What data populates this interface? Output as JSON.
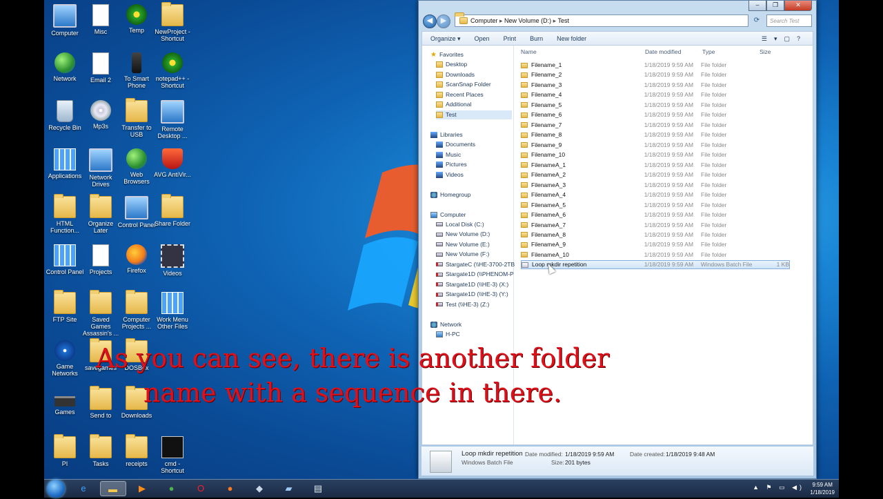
{
  "desktop": {
    "icons": [
      {
        "label": "Computer",
        "type": "monitor"
      },
      {
        "label": "Misc",
        "type": "docicon"
      },
      {
        "label": "Temp",
        "type": "green"
      },
      {
        "label": "NewProject - Shortcut",
        "type": "folder"
      },
      {
        "label": "Network",
        "type": "globe"
      },
      {
        "label": "Email 2",
        "type": "docicon"
      },
      {
        "label": "To Smart Phone",
        "type": "phone"
      },
      {
        "label": "notepad++ - Shortcut",
        "type": "green"
      },
      {
        "label": "Recycle Bin",
        "type": "bin"
      },
      {
        "label": "Mp3s",
        "type": "cd"
      },
      {
        "label": "Transfer to USB",
        "type": "folder"
      },
      {
        "label": "Remote Desktop ...",
        "type": "monitor"
      },
      {
        "label": "Applications",
        "type": "grid4"
      },
      {
        "label": "Network Drives",
        "type": "monitor"
      },
      {
        "label": "Web Browsers",
        "type": "globe"
      },
      {
        "label": "AVG AntiVir...",
        "type": "redshield"
      },
      {
        "label": "HTML Function...",
        "type": "folder"
      },
      {
        "label": "Organize Later",
        "type": "folder"
      },
      {
        "label": "Control Panel",
        "type": "monitor"
      },
      {
        "label": "Share Folder",
        "type": "folder"
      },
      {
        "label": "Control Panel",
        "type": "grid4"
      },
      {
        "label": "Projects",
        "type": "docicon"
      },
      {
        "label": "Firefox",
        "type": "firefox"
      },
      {
        "label": "Videos",
        "type": "film"
      },
      {
        "label": "FTP Site",
        "type": "folder"
      },
      {
        "label": "Saved Games Assassin's ...",
        "type": "folder"
      },
      {
        "label": "Computer Projects ...",
        "type": "folder"
      },
      {
        "label": "Work Menu Other Files",
        "type": "grid4"
      },
      {
        "label": "Game Networks",
        "type": "speaker"
      },
      {
        "label": "savegames",
        "type": "folder"
      },
      {
        "label": "DOSBox",
        "type": "folder"
      },
      {
        "label": "",
        "type": "none"
      },
      {
        "label": "Games",
        "type": "chip"
      },
      {
        "label": "Send to",
        "type": "folder"
      },
      {
        "label": "Downloads",
        "type": "folder"
      },
      {
        "label": "",
        "type": "none"
      },
      {
        "label": "PI",
        "type": "folder"
      },
      {
        "label": "Tasks",
        "type": "folder"
      },
      {
        "label": "receipts",
        "type": "folder"
      },
      {
        "label": "cmd - Shortcut",
        "type": "cmd"
      }
    ]
  },
  "explorer": {
    "address_parts": [
      "Computer",
      "New Volume (D:)",
      "Test"
    ],
    "search_placeholder": "Search Test",
    "toolbar": {
      "organize": "Organize ▾",
      "open": "Open",
      "print": "Print",
      "burn": "Burn",
      "new_folder": "New folder"
    },
    "nav": [
      {
        "label": "Favorites",
        "icon": "star",
        "indent": 0
      },
      {
        "label": "Desktop",
        "icon": "fold",
        "indent": 1
      },
      {
        "label": "Downloads",
        "icon": "fold",
        "indent": 1
      },
      {
        "label": "ScanSnap Folder",
        "icon": "fold",
        "indent": 1
      },
      {
        "label": "Recent Places",
        "icon": "fold",
        "indent": 1
      },
      {
        "label": "Additional",
        "icon": "fold",
        "indent": 1
      },
      {
        "label": "Test",
        "icon": "fold",
        "indent": 1,
        "selected": true
      },
      {
        "label": "",
        "icon": "none",
        "indent": 0
      },
      {
        "label": "Libraries",
        "icon": "lib",
        "indent": 0
      },
      {
        "label": "Documents",
        "icon": "lib",
        "indent": 1
      },
      {
        "label": "Music",
        "icon": "lib",
        "indent": 1
      },
      {
        "label": "Pictures",
        "icon": "lib",
        "indent": 1
      },
      {
        "label": "Videos",
        "icon": "lib",
        "indent": 1
      },
      {
        "label": "",
        "icon": "none",
        "indent": 0
      },
      {
        "label": "Homegroup",
        "icon": "net",
        "indent": 0
      },
      {
        "label": "",
        "icon": "none",
        "indent": 0
      },
      {
        "label": "Computer",
        "icon": "comp",
        "indent": 0
      },
      {
        "label": "Local Disk (C:)",
        "icon": "drive",
        "indent": 1
      },
      {
        "label": "New Volume (D:)",
        "icon": "drive",
        "indent": 1
      },
      {
        "label": "New Volume (E:)",
        "icon": "drive",
        "indent": 1
      },
      {
        "label": "New Volume (F:)",
        "icon": "drive",
        "indent": 1
      },
      {
        "label": "StargateC (\\\\HE-3700-2TB",
        "icon": "netdrive",
        "indent": 1
      },
      {
        "label": "Stargate1D (\\\\PHENOM-P",
        "icon": "netdrive",
        "indent": 1
      },
      {
        "label": "Stargate1D (\\\\HE-3) (X:)",
        "icon": "netdrive",
        "indent": 1
      },
      {
        "label": "Stargate1D (\\\\HE-3) (Y:)",
        "icon": "netdrive",
        "indent": 1
      },
      {
        "label": "Test (\\\\HE-3) (Z:)",
        "icon": "netdrive",
        "indent": 1
      },
      {
        "label": "",
        "icon": "none",
        "indent": 0
      },
      {
        "label": "Network",
        "icon": "net",
        "indent": 0
      },
      {
        "label": "H-PC",
        "icon": "comp",
        "indent": 1
      }
    ],
    "columns": {
      "name": "Name",
      "date": "Date modified",
      "type": "Type",
      "size": "Size"
    },
    "files": [
      {
        "name": "Filename_1",
        "date": "1/18/2019 9:59 AM",
        "type": "File folder",
        "size": ""
      },
      {
        "name": "Filename_2",
        "date": "1/18/2019 9:59 AM",
        "type": "File folder",
        "size": ""
      },
      {
        "name": "Filename_3",
        "date": "1/18/2019 9:59 AM",
        "type": "File folder",
        "size": ""
      },
      {
        "name": "Filename_4",
        "date": "1/18/2019 9:59 AM",
        "type": "File folder",
        "size": ""
      },
      {
        "name": "Filename_5",
        "date": "1/18/2019 9:59 AM",
        "type": "File folder",
        "size": ""
      },
      {
        "name": "Filename_6",
        "date": "1/18/2019 9:59 AM",
        "type": "File folder",
        "size": ""
      },
      {
        "name": "Filename_7",
        "date": "1/18/2019 9:59 AM",
        "type": "File folder",
        "size": ""
      },
      {
        "name": "Filename_8",
        "date": "1/18/2019 9:59 AM",
        "type": "File folder",
        "size": ""
      },
      {
        "name": "Filename_9",
        "date": "1/18/2019 9:59 AM",
        "type": "File folder",
        "size": ""
      },
      {
        "name": "Filename_10",
        "date": "1/18/2019 9:59 AM",
        "type": "File folder",
        "size": ""
      },
      {
        "name": "FilenameA_1",
        "date": "1/18/2019 9:59 AM",
        "type": "File folder",
        "size": ""
      },
      {
        "name": "FilenameA_2",
        "date": "1/18/2019 9:59 AM",
        "type": "File folder",
        "size": ""
      },
      {
        "name": "FilenameA_3",
        "date": "1/18/2019 9:59 AM",
        "type": "File folder",
        "size": ""
      },
      {
        "name": "FilenameA_4",
        "date": "1/18/2019 9:59 AM",
        "type": "File folder",
        "size": ""
      },
      {
        "name": "FilenameA_5",
        "date": "1/18/2019 9:59 AM",
        "type": "File folder",
        "size": ""
      },
      {
        "name": "FilenameA_6",
        "date": "1/18/2019 9:59 AM",
        "type": "File folder",
        "size": ""
      },
      {
        "name": "FilenameA_7",
        "date": "1/18/2019 9:59 AM",
        "type": "File folder",
        "size": ""
      },
      {
        "name": "FilenameA_8",
        "date": "1/18/2019 9:59 AM",
        "type": "File folder",
        "size": ""
      },
      {
        "name": "FilenameA_9",
        "date": "1/18/2019 9:59 AM",
        "type": "File folder",
        "size": ""
      },
      {
        "name": "FilenameA_10",
        "date": "1/18/2019 9:59 AM",
        "type": "File folder",
        "size": ""
      },
      {
        "name": "Loop mkdir repetition",
        "date": "1/18/2019 9:59 AM",
        "type": "Windows Batch File",
        "size": "1 KB",
        "selected": true
      }
    ],
    "details": {
      "name": "Loop mkdir repetition",
      "type": "Windows Batch File",
      "modified_label": "Date modified:",
      "modified": "1/18/2019 9:59 AM",
      "size_label": "Size:",
      "size": "201 bytes",
      "created_label": "Date created:",
      "created": "1/18/2019 9:48 AM"
    }
  },
  "caption": {
    "line1": "As you can see, there is another folder",
    "line2": "name with a sequence in there."
  },
  "taskbar": {
    "time": "9:59 AM",
    "date": "1/18/2019",
    "buttons": [
      {
        "name": "ie",
        "glyph": "e",
        "color": "#3aa0ff"
      },
      {
        "name": "explorer",
        "glyph": "▬",
        "color": "#f2c94c",
        "active": true
      },
      {
        "name": "media-player",
        "glyph": "▶",
        "color": "#ff8c1a"
      },
      {
        "name": "chrome",
        "glyph": "●",
        "color": "#4caf50"
      },
      {
        "name": "opera",
        "glyph": "O",
        "color": "#ff1b2d"
      },
      {
        "name": "firefox",
        "glyph": "●",
        "color": "#ff7a1a"
      },
      {
        "name": "app-1",
        "glyph": "◆",
        "color": "#c8d6e8"
      },
      {
        "name": "app-2",
        "glyph": "▰",
        "color": "#9cc7f0"
      },
      {
        "name": "app-3",
        "glyph": "▤",
        "color": "#dfe8f0"
      }
    ]
  }
}
